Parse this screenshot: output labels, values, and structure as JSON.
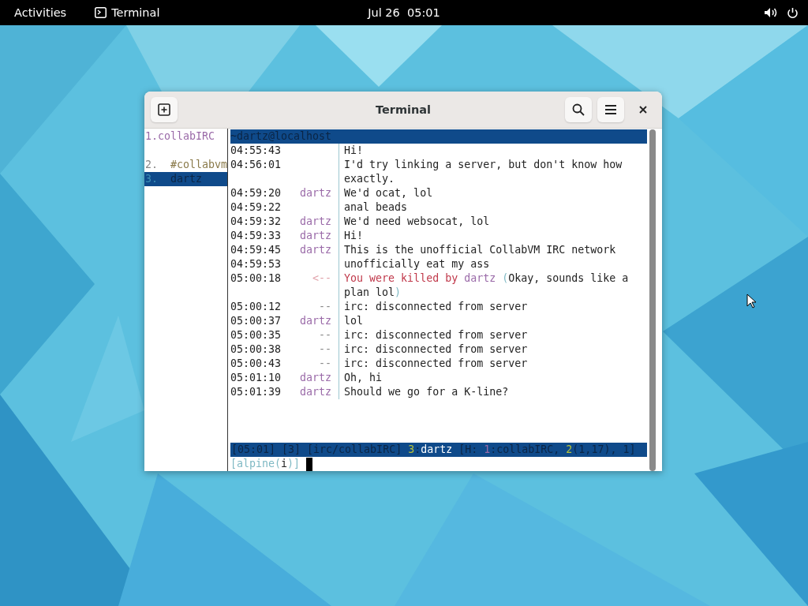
{
  "top_bar": {
    "activities": "Activities",
    "app": "Terminal",
    "clock": "Jul 26  05:01"
  },
  "window": {
    "title": "Terminal"
  },
  "buffers": [
    {
      "number": "1.",
      "name": "collabIRC",
      "kind": "server",
      "selected": false
    },
    {
      "number": "2.",
      "name": "#collabvm",
      "kind": "channel",
      "selected": false
    },
    {
      "number": "3.",
      "name": "dartz",
      "kind": "query",
      "selected": true
    }
  ],
  "title_line": "~dartz@localhost",
  "messages": [
    {
      "time": "04:55:43",
      "text": "Hi!"
    },
    {
      "time": "04:56:01",
      "text": "I'd try linking a server, but don't know how exactly."
    },
    {
      "time": "04:59:20",
      "prefix": "dartz",
      "kind": "nick",
      "text": "We'd ocat, lol"
    },
    {
      "time": "04:59:22",
      "text": "anal beads"
    },
    {
      "time": "04:59:32",
      "prefix": "dartz",
      "kind": "nick",
      "text": "We'd need websocat, lol"
    },
    {
      "time": "04:59:33",
      "prefix": "dartz",
      "kind": "nick",
      "text": "Hi!"
    },
    {
      "time": "04:59:45",
      "prefix": "dartz",
      "kind": "nick",
      "text": "This is the unofficial CollabVM IRC network"
    },
    {
      "time": "04:59:53",
      "text": "unofficially eat my ass"
    },
    {
      "time": "05:00:18",
      "prefix": "<--",
      "kind": "quit",
      "segments": [
        {
          "kind": "error",
          "text": "You were killed by "
        },
        {
          "kind": "nick",
          "text": "dartz"
        },
        {
          "kind": "delim",
          "text": " ("
        },
        {
          "kind": "plain",
          "text": "Okay, sounds like a plan lol"
        },
        {
          "kind": "delim",
          "text": ")"
        }
      ]
    },
    {
      "time": "05:00:12",
      "prefix": "--",
      "kind": "network",
      "text": "irc: disconnected from server"
    },
    {
      "time": "05:00:37",
      "prefix": "dartz",
      "kind": "nick",
      "text": "lol"
    },
    {
      "time": "05:00:35",
      "prefix": "--",
      "kind": "network",
      "text": "irc: disconnected from server"
    },
    {
      "time": "05:00:38",
      "prefix": "--",
      "kind": "network",
      "text": "irc: disconnected from server"
    },
    {
      "time": "05:00:43",
      "prefix": "--",
      "kind": "network",
      "text": "irc: disconnected from server"
    },
    {
      "time": "05:01:10",
      "prefix": "dartz",
      "kind": "nick",
      "text": "Oh, hi"
    },
    {
      "time": "05:01:39",
      "prefix": "dartz",
      "kind": "nick",
      "text": "Should we go for a K-line?"
    }
  ],
  "status_bar": [
    {
      "kind": "dim",
      "text": "[05:01] [3] [irc/collabIRC] "
    },
    {
      "kind": "accent",
      "text": "3"
    },
    {
      "kind": "dim",
      "text": ":"
    },
    {
      "kind": "bright",
      "text": "dartz"
    },
    {
      "kind": "dim",
      "text": " [H: "
    },
    {
      "kind": "hot",
      "text": "1"
    },
    {
      "kind": "dim",
      "text": ":collabIRC, "
    },
    {
      "kind": "accent",
      "text": "2"
    },
    {
      "kind": "dim",
      "text": "(1,17), 1]"
    }
  ],
  "input_line": [
    {
      "kind": "delim",
      "text": "[alpine("
    },
    {
      "kind": "plain",
      "text": "i"
    },
    {
      "kind": "delim",
      "text": ")]"
    }
  ]
}
